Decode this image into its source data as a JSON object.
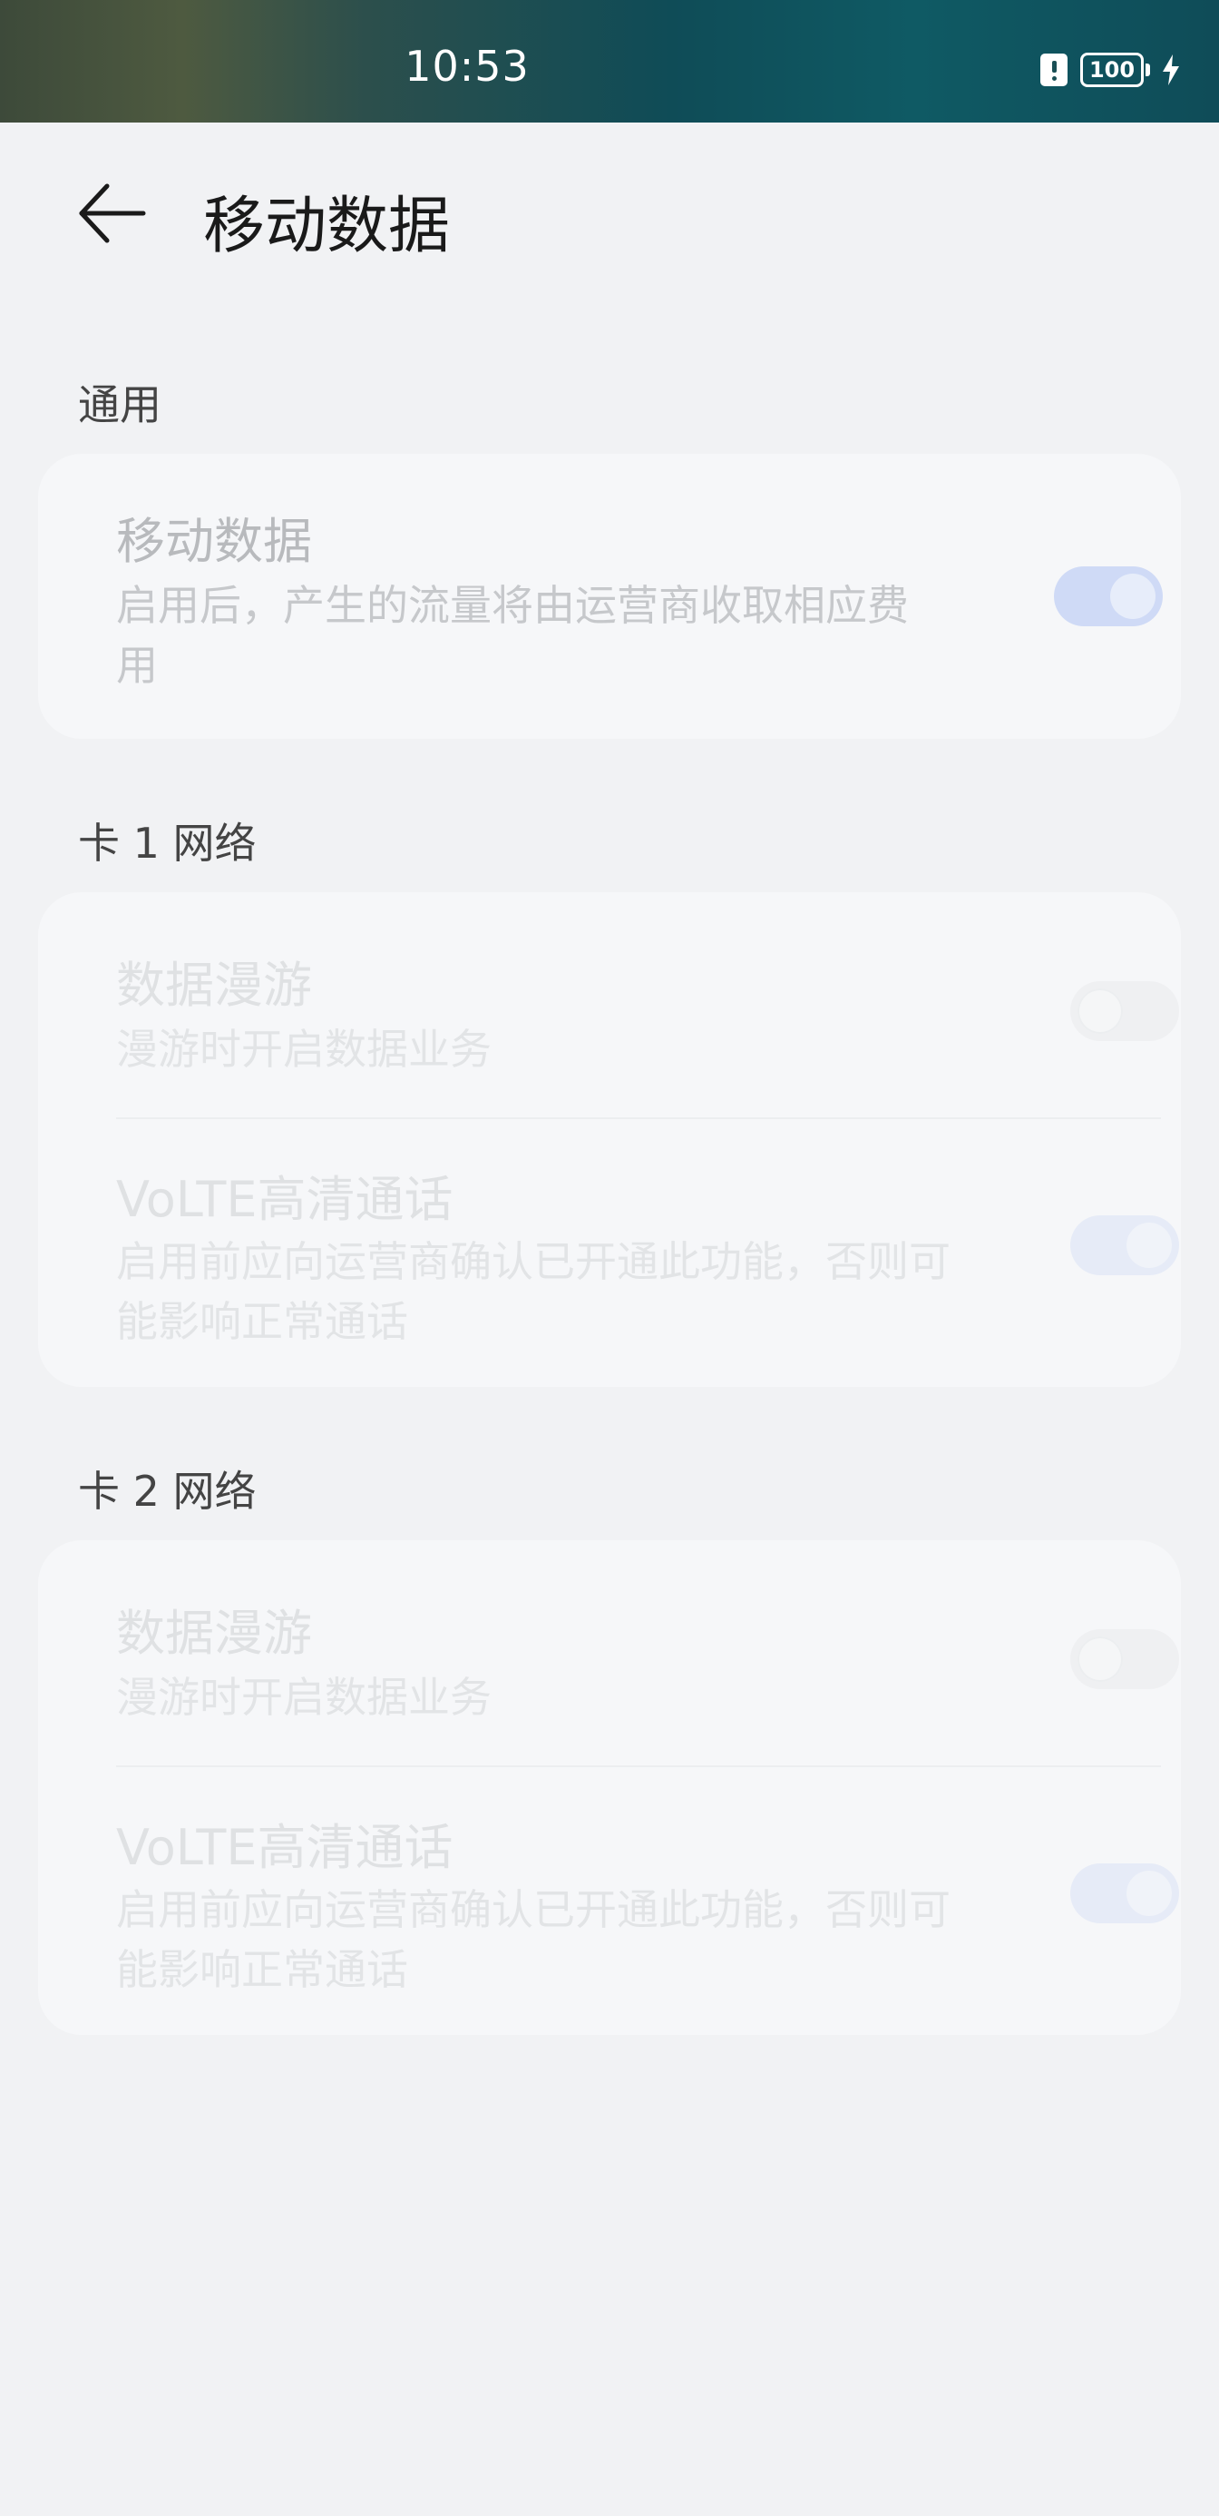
{
  "status_bar": {
    "time": "10:53",
    "battery": "100",
    "icons": [
      "sim-alert-icon",
      "battery-icon",
      "charging-icon"
    ]
  },
  "header": {
    "title": "移动数据",
    "back_icon": "arrow-left-icon"
  },
  "sections": {
    "general": {
      "header": "通用",
      "mobile_data": {
        "title": "移动数据",
        "description": "启用后，产生的流量将由运营商收取相应费用",
        "enabled": true
      }
    },
    "sim1": {
      "header": "卡 1 网络",
      "data_roaming": {
        "title": "数据漫游",
        "description": "漫游时开启数据业务",
        "enabled": false
      },
      "volte": {
        "title": "VoLTE高清通话",
        "description": "启用前应向运营商确认已开通此功能，否则可能影响正常通话",
        "enabled": true
      }
    },
    "sim2": {
      "header": "卡 2 网络",
      "data_roaming": {
        "title": "数据漫游",
        "description": "漫游时开启数据业务",
        "enabled": false
      },
      "volte": {
        "title": "VoLTE高清通话",
        "description": "启用前应向运营商确认已开通此功能，否则可能影响正常通话",
        "enabled": true
      }
    }
  },
  "colors": {
    "switch_on": "#cfdaf6",
    "background": "#f1f2f4",
    "card": "#f6f7f9"
  }
}
